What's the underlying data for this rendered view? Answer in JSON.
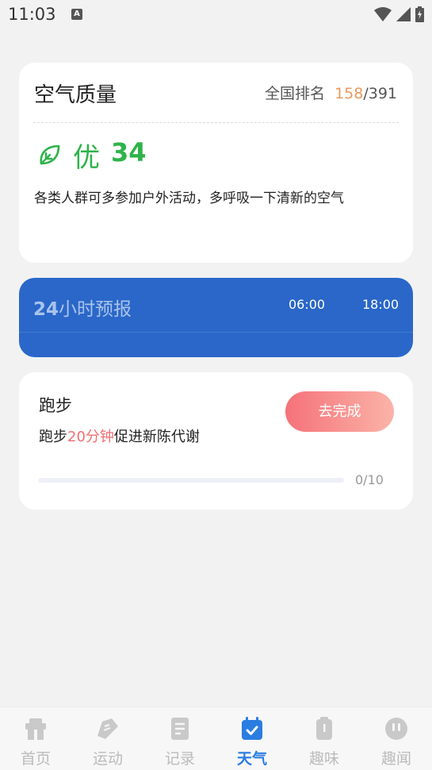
{
  "status_bar": {
    "time": "11:03",
    "notification_icon": "A"
  },
  "air_quality": {
    "title": "空气质量",
    "rank_label": "全国排名",
    "rank_value": "158",
    "rank_total": "/391",
    "level": "优",
    "value": "34",
    "description": "各类人群可多参加户外活动，多呼吸一下清新的空气",
    "accent_color": "#2eb34a"
  },
  "forecast": {
    "title_prefix": "24",
    "title_suffix": "小时预报",
    "times": [
      "06:00",
      "18:00"
    ],
    "color": "#2a67c9"
  },
  "task": {
    "title": "跑步",
    "desc_prefix": "跑步",
    "desc_highlight": "20分钟",
    "desc_suffix": "促进新陈代谢",
    "button_label": "去完成",
    "progress_current": 0,
    "progress_total": 10,
    "progress_text": "0/10"
  },
  "nav": {
    "items": [
      {
        "label": "首页",
        "icon": "home-icon"
      },
      {
        "label": "运动",
        "icon": "shoe-icon"
      },
      {
        "label": "记录",
        "icon": "document-icon"
      },
      {
        "label": "天气",
        "icon": "calendar-check-icon",
        "active": true
      },
      {
        "label": "趣味",
        "icon": "fun-icon"
      },
      {
        "label": "趣闻",
        "icon": "chat-icon"
      }
    ]
  }
}
